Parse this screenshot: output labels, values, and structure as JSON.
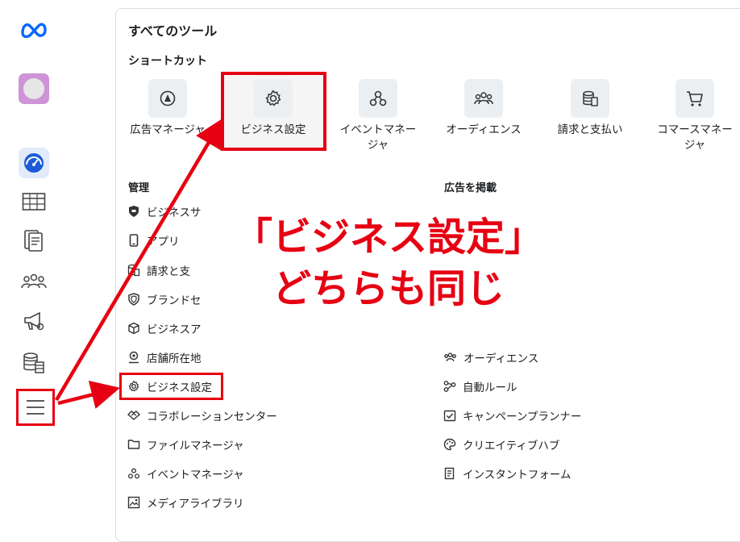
{
  "header": {
    "title": "すべてのツール",
    "shortcuts_title": "ショートカット"
  },
  "shortcuts": [
    {
      "label": "広告マネージャ",
      "icon": "ads-manager-icon"
    },
    {
      "label": "ビジネス設定",
      "icon": "gear-icon"
    },
    {
      "label": "イベントマネー\nジャ",
      "icon": "events-icon"
    },
    {
      "label": "オーディエンス",
      "icon": "audience-icon"
    },
    {
      "label": "請求と支払い",
      "icon": "billing-icon"
    },
    {
      "label": "コマースマネー\nジャ",
      "icon": "cart-icon"
    }
  ],
  "manage": {
    "title": "管理",
    "items": [
      {
        "label": "ビジネスサ",
        "icon": "shield-icon"
      },
      {
        "label": "アプリ",
        "icon": "phone-icon"
      },
      {
        "label": "請求と支",
        "icon": "billing-icon"
      },
      {
        "label": "ブランドセ",
        "icon": "brand-safety-icon"
      },
      {
        "label": "ビジネスア",
        "icon": "cube-icon"
      },
      {
        "label": "店舗所在地",
        "icon": "location-icon"
      },
      {
        "label": "ビジネス設定",
        "icon": "gear-icon"
      },
      {
        "label": "コラボレーションセンター",
        "icon": "handshake-icon"
      },
      {
        "label": "ファイルマネージャ",
        "icon": "folder-icon"
      },
      {
        "label": "イベントマネージャ",
        "icon": "events-icon"
      },
      {
        "label": "メディアライブラリ",
        "icon": "image-icon"
      }
    ]
  },
  "advertise": {
    "title": "広告を掲載",
    "items": [
      {
        "label": "オーディエンス",
        "icon": "audience-icon"
      },
      {
        "label": "自動ルール",
        "icon": "rules-icon"
      },
      {
        "label": "キャンペーンプランナー",
        "icon": "calendar-check-icon"
      },
      {
        "label": "クリエイティブハブ",
        "icon": "palette-icon"
      },
      {
        "label": "インスタントフォーム",
        "icon": "form-icon"
      }
    ]
  },
  "overlay": {
    "line1": "「ビジネス設定」",
    "line2": "どちらも同じ"
  },
  "colors": {
    "annotation_red": "#e60012",
    "meta_blue": "#0866ff"
  }
}
